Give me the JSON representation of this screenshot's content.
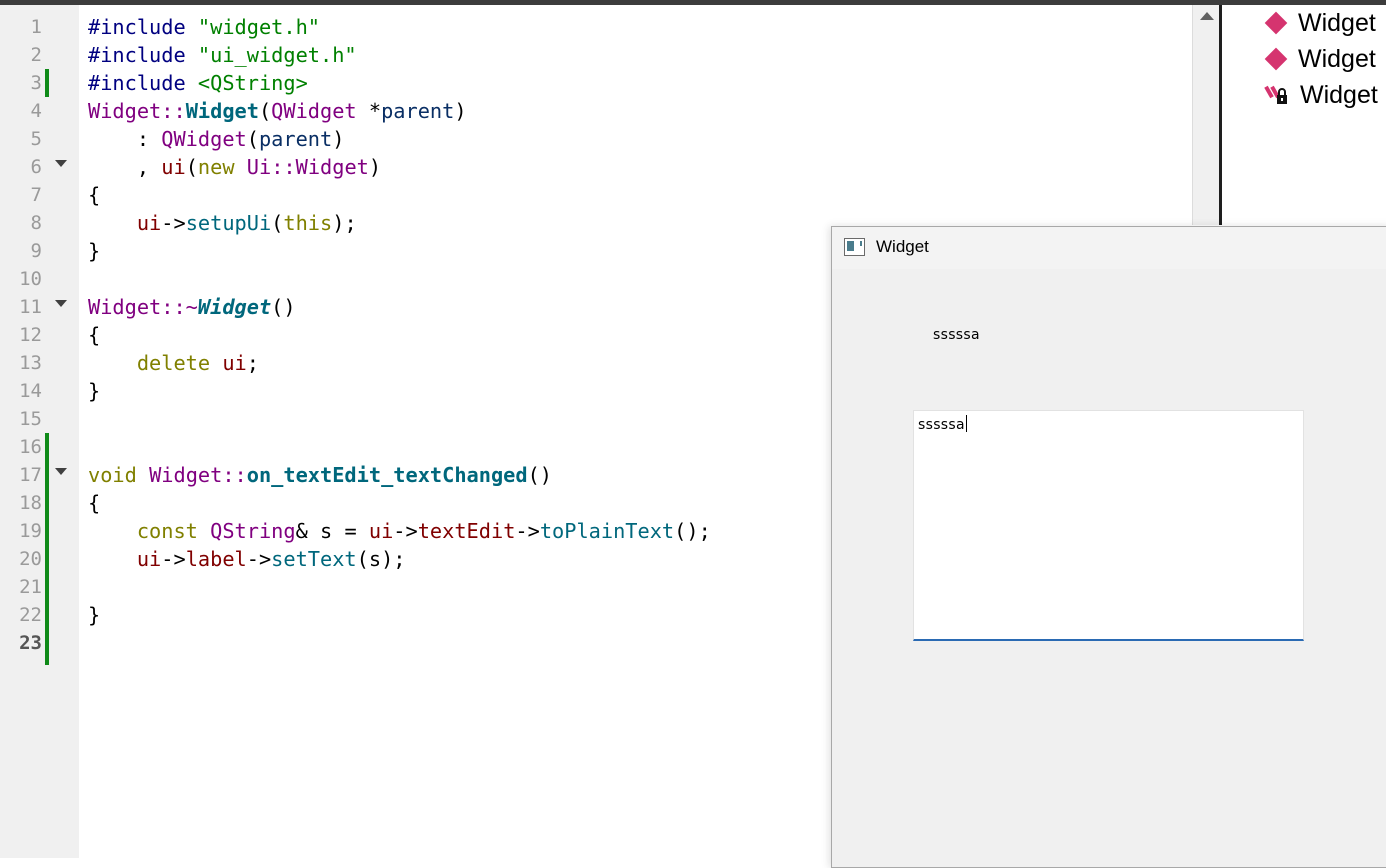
{
  "editor": {
    "line_numbers": [
      "1",
      "2",
      "3",
      "4",
      "5",
      "6",
      "7",
      "8",
      "9",
      "10",
      "11",
      "12",
      "13",
      "14",
      "15",
      "16",
      "17",
      "18",
      "19",
      "20",
      "21",
      "22",
      "23"
    ],
    "current_line": "23",
    "lines": {
      "l1_a": "#include ",
      "l1_b": "\"widget.h\"",
      "l2_a": "#include ",
      "l2_b": "\"ui_widget.h\"",
      "l3_a": "#include ",
      "l3_b": "<QString>",
      "l4_a": "Widget",
      "l4_b": "::",
      "l4_c": "Widget",
      "l4_d": "(",
      "l4_e": "QWidget",
      "l4_f": " *",
      "l4_g": "parent",
      "l4_h": ")",
      "l5_a": "    : ",
      "l5_b": "QWidget",
      "l5_c": "(",
      "l5_d": "parent",
      "l5_e": ")",
      "l6_a": "    , ",
      "l6_b": "ui",
      "l6_c": "(",
      "l6_d": "new",
      "l6_e": " ",
      "l6_f": "Ui",
      "l6_g": "::",
      "l6_h": "Widget",
      "l6_i": ")",
      "l7": "{",
      "l8_a": "    ",
      "l8_b": "ui",
      "l8_c": "->",
      "l8_d": "setupUi",
      "l8_e": "(",
      "l8_f": "this",
      "l8_g": ");",
      "l9": "}",
      "l11_a": "Widget",
      "l11_b": "::~",
      "l11_c": "Widget",
      "l11_d": "()",
      "l12": "{",
      "l13_a": "    ",
      "l13_b": "delete",
      "l13_c": " ",
      "l13_d": "ui",
      "l13_e": ";",
      "l14": "}",
      "l17_a": "void",
      "l17_b": " ",
      "l17_c": "Widget",
      "l17_d": "::",
      "l17_e": "on_textEdit_textChanged",
      "l17_f": "()",
      "l18": "{",
      "l19_a": "    ",
      "l19_b": "const",
      "l19_c": " ",
      "l19_d": "QString",
      "l19_e": "& s = ",
      "l19_f": "ui",
      "l19_g": "->",
      "l19_h": "textEdit",
      "l19_i": "->",
      "l19_j": "toPlainText",
      "l19_k": "();",
      "l20_a": "    ",
      "l20_b": "ui",
      "l20_c": "->",
      "l20_d": "label",
      "l20_e": "->",
      "l20_f": "setText",
      "l20_g": "(s);",
      "l22": "}"
    }
  },
  "outline": {
    "items": [
      {
        "label": "Widget",
        "icon": "function-icon"
      },
      {
        "label": "Widget",
        "icon": "function-icon"
      },
      {
        "label": "Widget",
        "icon": "private-member-lock-icon"
      }
    ]
  },
  "widget_window": {
    "title": "Widget",
    "label_text": "sssssa",
    "textedit_value": "sssssa"
  }
}
